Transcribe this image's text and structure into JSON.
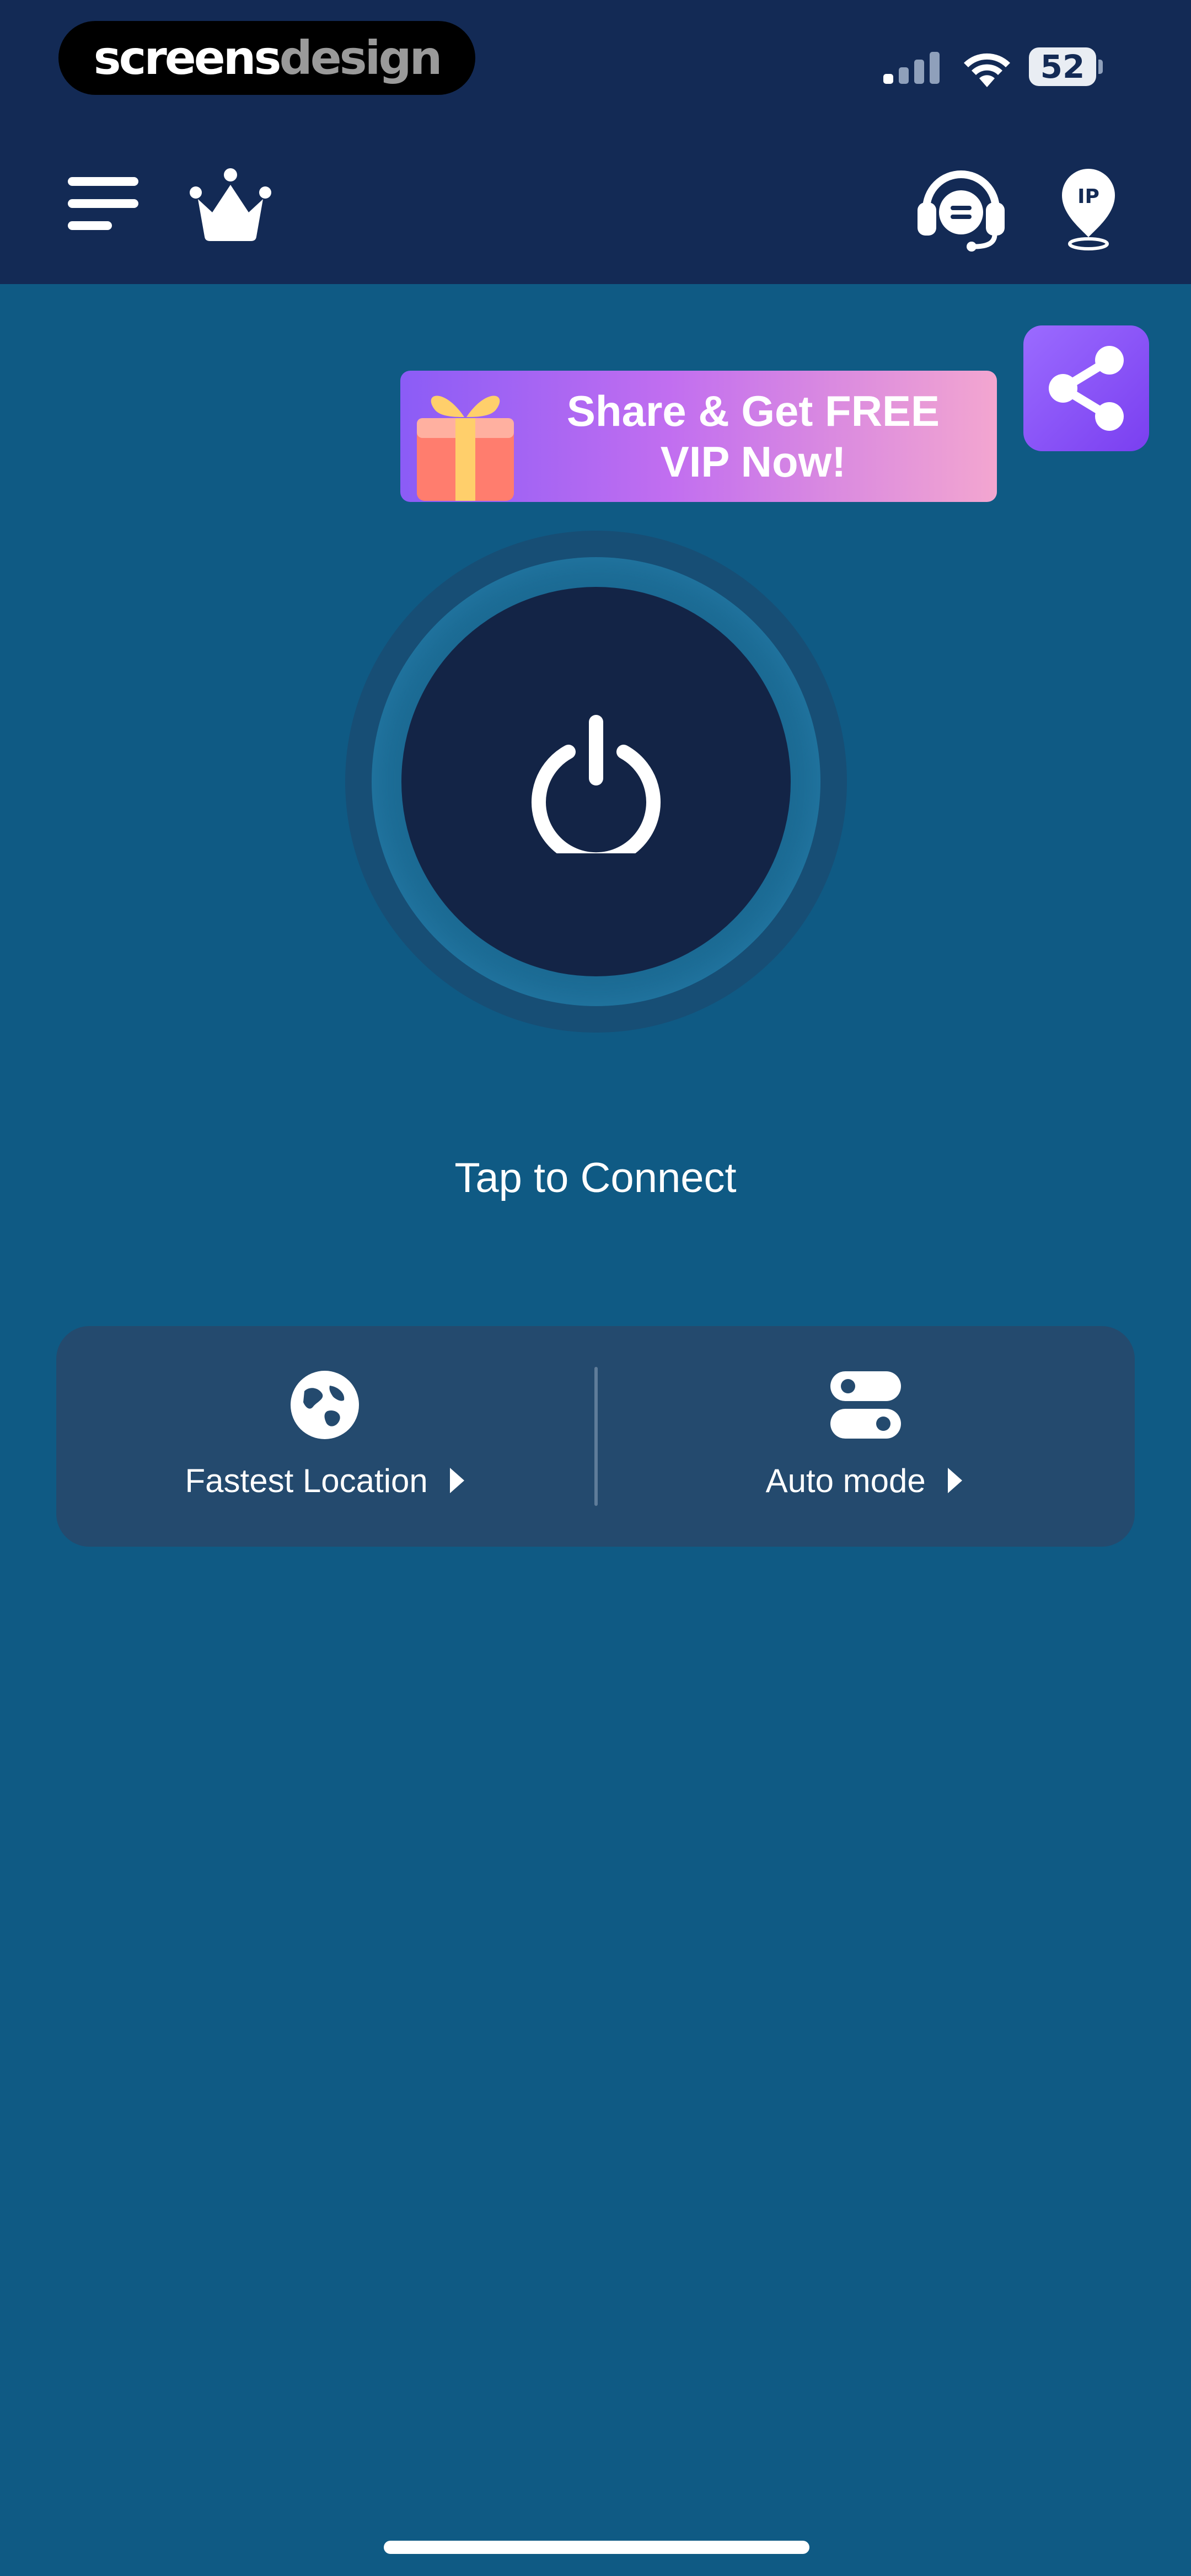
{
  "watermark": {
    "part1": "screens",
    "part2": "design"
  },
  "status_bar": {
    "battery": "52"
  },
  "header": {
    "menu_icon": "menu-icon",
    "premium_icon": "crown-icon",
    "support_icon": "headset-icon",
    "ip_icon": "ip-location-icon",
    "ip_label": "IP"
  },
  "promo": {
    "text": "Share & Get FREE\nVIP Now!",
    "share_icon": "share-icon"
  },
  "power": {
    "label": "Tap to Connect",
    "icon": "power-icon"
  },
  "options": [
    {
      "label": "Fastest Location",
      "icon": "globe-icon"
    },
    {
      "label": "Auto mode",
      "icon": "toggle-icon"
    }
  ],
  "colors": {
    "background": "#0f5a84",
    "header": "#132a55",
    "accent": "#8b5cf6"
  }
}
